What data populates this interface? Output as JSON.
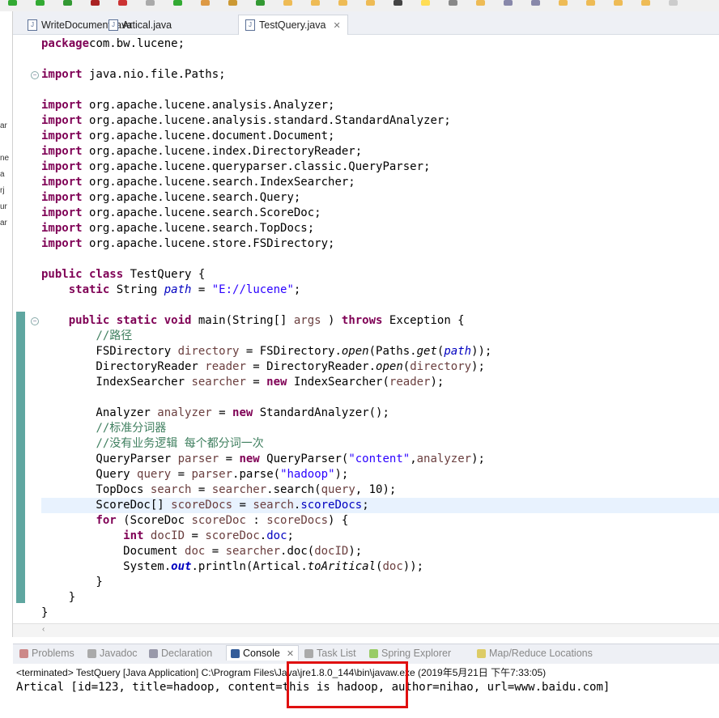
{
  "tabs": [
    {
      "label": "WriteDocument.java",
      "active": false
    },
    {
      "label": "Artical.java",
      "active": false
    },
    {
      "label": "TestQuery.java",
      "active": true
    }
  ],
  "left_fragments": [
    "ar",
    "ne",
    "a",
    "rj",
    "ur",
    "ar"
  ],
  "code": [
    [
      [
        "kw",
        "package"
      ],
      [
        "",
        "com.bw.lucene;"
      ]
    ],
    [],
    [
      [
        "kw",
        "import"
      ],
      [
        "",
        " java.nio.file.Paths;"
      ]
    ],
    [],
    [
      [
        "kw",
        "import"
      ],
      [
        "",
        " org.apache.lucene.analysis.Analyzer;"
      ]
    ],
    [
      [
        "kw",
        "import"
      ],
      [
        "",
        " org.apache.lucene.analysis.standard.StandardAnalyzer;"
      ]
    ],
    [
      [
        "kw",
        "import"
      ],
      [
        "",
        " org.apache.lucene.document.Document;"
      ]
    ],
    [
      [
        "kw",
        "import"
      ],
      [
        "",
        " org.apache.lucene.index.DirectoryReader;"
      ]
    ],
    [
      [
        "kw",
        "import"
      ],
      [
        "",
        " org.apache.lucene.queryparser.classic.QueryParser;"
      ]
    ],
    [
      [
        "kw",
        "import"
      ],
      [
        "",
        " org.apache.lucene.search.IndexSearcher;"
      ]
    ],
    [
      [
        "kw",
        "import"
      ],
      [
        "",
        " org.apache.lucene.search.Query;"
      ]
    ],
    [
      [
        "kw",
        "import"
      ],
      [
        "",
        " org.apache.lucene.search.ScoreDoc;"
      ]
    ],
    [
      [
        "kw",
        "import"
      ],
      [
        "",
        " org.apache.lucene.search.TopDocs;"
      ]
    ],
    [
      [
        "kw",
        "import"
      ],
      [
        "",
        " org.apache.lucene.store.FSDirectory;"
      ]
    ],
    [],
    [
      [
        "kw",
        "public class"
      ],
      [
        "",
        " TestQuery {"
      ]
    ],
    [
      [
        "",
        "    "
      ],
      [
        "kw",
        "static"
      ],
      [
        "",
        " String "
      ],
      [
        "fi",
        "path"
      ],
      [
        "",
        " = "
      ],
      [
        "st",
        "\"E://lucene\""
      ],
      [
        "",
        ";"
      ]
    ],
    [],
    [
      [
        "",
        "    "
      ],
      [
        "kw",
        "public static void"
      ],
      [
        "",
        " main(String[] "
      ],
      [
        "va",
        "args"
      ],
      [
        "",
        " ) "
      ],
      [
        "kw",
        "throws"
      ],
      [
        "",
        " Exception {"
      ]
    ],
    [
      [
        "",
        "        "
      ],
      [
        "cm",
        "//路径"
      ]
    ],
    [
      [
        "",
        "        FSDirectory "
      ],
      [
        "va",
        "directory"
      ],
      [
        "",
        " = FSDirectory."
      ],
      [
        "me",
        "open"
      ],
      [
        "",
        "(Paths."
      ],
      [
        "me",
        "get"
      ],
      [
        "",
        "("
      ],
      [
        "fi",
        "path"
      ],
      [
        "",
        "));"
      ]
    ],
    [
      [
        "",
        "        DirectoryReader "
      ],
      [
        "va",
        "reader"
      ],
      [
        "",
        " = DirectoryReader."
      ],
      [
        "me",
        "open"
      ],
      [
        "",
        "("
      ],
      [
        "va",
        "directory"
      ],
      [
        "",
        ");"
      ]
    ],
    [
      [
        "",
        "        IndexSearcher "
      ],
      [
        "va",
        "searcher"
      ],
      [
        "",
        " = "
      ],
      [
        "kw",
        "new"
      ],
      [
        "",
        " IndexSearcher("
      ],
      [
        "va",
        "reader"
      ],
      [
        "",
        ");"
      ]
    ],
    [],
    [
      [
        "",
        "        Analyzer "
      ],
      [
        "va",
        "analyzer"
      ],
      [
        "",
        " = "
      ],
      [
        "kw",
        "new"
      ],
      [
        "",
        " StandardAnalyzer();"
      ]
    ],
    [
      [
        "",
        "        "
      ],
      [
        "cm",
        "//标准分词器"
      ]
    ],
    [
      [
        "",
        "        "
      ],
      [
        "cm",
        "//没有业务逻辑 每个都分词一次"
      ]
    ],
    [
      [
        "",
        "        QueryParser "
      ],
      [
        "va",
        "parser"
      ],
      [
        "",
        " = "
      ],
      [
        "kw",
        "new"
      ],
      [
        "",
        " QueryParser("
      ],
      [
        "st",
        "\"content\""
      ],
      [
        "",
        ","
      ],
      [
        "va",
        "analyzer"
      ],
      [
        "",
        ");"
      ]
    ],
    [
      [
        "",
        "        Query "
      ],
      [
        "va",
        "query"
      ],
      [
        "",
        " = "
      ],
      [
        "va",
        "parser"
      ],
      [
        "",
        ".parse("
      ],
      [
        "st",
        "\"hadoop\""
      ],
      [
        "",
        ");"
      ]
    ],
    [
      [
        "",
        "        TopDocs "
      ],
      [
        "va",
        "search"
      ],
      [
        "",
        " = "
      ],
      [
        "va",
        "searcher"
      ],
      [
        "",
        ".search("
      ],
      [
        "va",
        "query"
      ],
      [
        "",
        ", 10);"
      ]
    ],
    [
      [
        "",
        "        ScoreDoc[] "
      ],
      [
        "va",
        "scoreDocs"
      ],
      [
        "",
        " = "
      ],
      [
        "va",
        "search"
      ],
      [
        "",
        "."
      ],
      [
        "fd",
        "scoreDocs"
      ],
      [
        "",
        ";"
      ]
    ],
    [
      [
        "",
        "        "
      ],
      [
        "kw",
        "for"
      ],
      [
        "",
        " (ScoreDoc "
      ],
      [
        "va",
        "scoreDoc"
      ],
      [
        "",
        " : "
      ],
      [
        "va",
        "scoreDocs"
      ],
      [
        "",
        ") {"
      ]
    ],
    [
      [
        "",
        "            "
      ],
      [
        "kw",
        "int"
      ],
      [
        "",
        " "
      ],
      [
        "va",
        "docID"
      ],
      [
        "",
        " = "
      ],
      [
        "va",
        "scoreDoc"
      ],
      [
        "",
        "."
      ],
      [
        "fd",
        "doc"
      ],
      [
        "",
        ";"
      ]
    ],
    [
      [
        "",
        "            Document "
      ],
      [
        "va",
        "doc"
      ],
      [
        "",
        " = "
      ],
      [
        "va",
        "searcher"
      ],
      [
        "",
        ".doc("
      ],
      [
        "va",
        "docID"
      ],
      [
        "",
        ");"
      ]
    ],
    [
      [
        "",
        "            System."
      ],
      [
        "fb",
        "out"
      ],
      [
        "",
        ".println(Artical."
      ],
      [
        "me",
        "toAritical"
      ],
      [
        "",
        "("
      ],
      [
        "va",
        "doc"
      ],
      [
        "",
        "));"
      ]
    ],
    [
      [
        "",
        "        }"
      ]
    ],
    [
      [
        "",
        "    }"
      ]
    ],
    [
      [
        "",
        "}"
      ]
    ]
  ],
  "highlight_line": 30,
  "views": [
    {
      "label": "Problems",
      "color": "#c88"
    },
    {
      "label": "Javadoc",
      "color": "#aaa"
    },
    {
      "label": "Declaration",
      "color": "#99a"
    },
    {
      "label": "Console",
      "color": "#335c99",
      "active": true
    },
    {
      "label": "Task List",
      "color": "#aaa"
    },
    {
      "label": "Spring Explorer",
      "color": "#9c6"
    },
    {
      "label": "Map/Reduce Locations",
      "color": "#dc6"
    }
  ],
  "console": {
    "status": "<terminated> TestQuery [Java Application] C:\\Program Files\\Java\\jre1.8.0_144\\bin\\javaw.exe (2019年5月21日 下午7:33:05)",
    "output": "Artical [id=123, title=hadoop, content=this is hadoop, author=nihao, url=www.baidu.com]"
  },
  "colors": {
    "annotation_box": "#e01010",
    "keyword": "#7f0055",
    "string": "#2a00ff",
    "comment": "#3f7f5f"
  }
}
